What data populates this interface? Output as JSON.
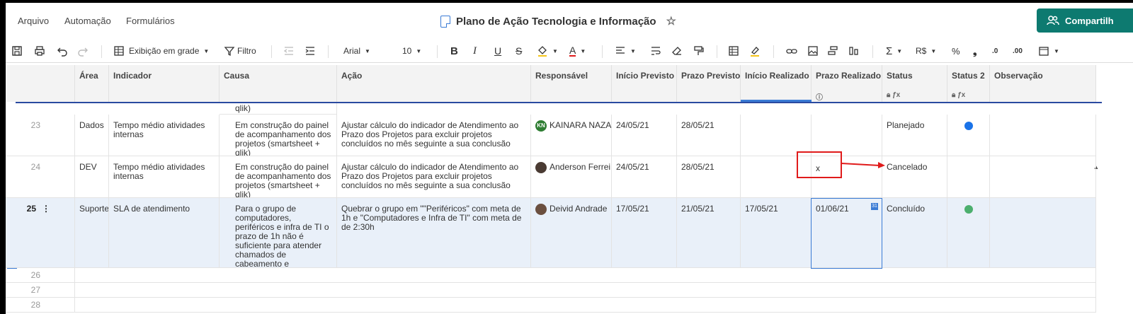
{
  "menu": [
    "Arquivo",
    "Automação",
    "Formulários"
  ],
  "doc_title": "Plano de Ação Tecnologia e Informação",
  "share_label": "Compartilh",
  "toolbar": {
    "view": "Exibição em grade",
    "filter": "Filtro",
    "font": "Arial",
    "size": "10",
    "currency": "R$",
    "percent": "%",
    "dec_less": ".0",
    "dec_more": ".00"
  },
  "columns": [
    "Área",
    "Indicador",
    "Causa",
    "Ação",
    "Responsável",
    "Início Previsto",
    "Prazo Previsto",
    "Início Realizado",
    "Prazo Realizado",
    "Status",
    "Status 2",
    "Observação"
  ],
  "partial_row_text": "qlik)",
  "rows": [
    {
      "num": "23",
      "area": "Dados",
      "indicador": "Tempo médio atividades internas",
      "causa": "Em construção do painel de acompanhamento dos projetos (smartsheet + qlik)",
      "acao": "Ajustar cálculo do indicador de Atendimento ao Prazo dos Projetos para excluir projetos concluídos no mês seguinte a sua conclusão",
      "responsavel": "KAINARA NAZA",
      "avatar": "KN",
      "inicio_previsto": "24/05/21",
      "prazo_previsto": "28/05/21",
      "inicio_realizado": "",
      "prazo_realizado": "",
      "status": "Planejado",
      "status2_color": "#1a73e8"
    },
    {
      "num": "24",
      "area": "DEV",
      "indicador": "Tempo médio atividades internas",
      "causa": "Em construção do painel de acompanhamento dos projetos (smartsheet + qlik)",
      "acao": "Ajustar cálculo do indicador de Atendimento ao Prazo dos Projetos para excluir projetos concluídos no mês seguinte a sua conclusão",
      "responsavel": "Anderson Ferrei",
      "avatar": "",
      "inicio_previsto": "24/05/21",
      "prazo_previsto": "28/05/21",
      "inicio_realizado": "",
      "prazo_realizado": "x",
      "status": "Cancelado",
      "status2_color": ""
    },
    {
      "num": "25",
      "area": "Suporte",
      "indicador": "SLA de atendimento",
      "causa": "Para o grupo de computadores, periféricos e infra de TI o prazo de 1h não é suficiente para atender chamados de cabeamento e formatação de computadores",
      "acao": "Quebrar o grupo em \"\"Periféricos\" com meta de 1h e \"Computadores e Infra de TI\" com meta de de 2:30h",
      "responsavel": "Deivid Andrade",
      "avatar": "",
      "inicio_previsto": "17/05/21",
      "prazo_previsto": "21/05/21",
      "inicio_realizado": "17/05/21",
      "prazo_realizado": "01/06/21",
      "status": "Concluído",
      "status2_color": "#4caf6e"
    }
  ],
  "empty_rows": [
    "26",
    "27",
    "28"
  ],
  "colors": {
    "accent": "#0d7a70",
    "selection": "#3a7bd5",
    "annotation": "#e01b1b"
  }
}
